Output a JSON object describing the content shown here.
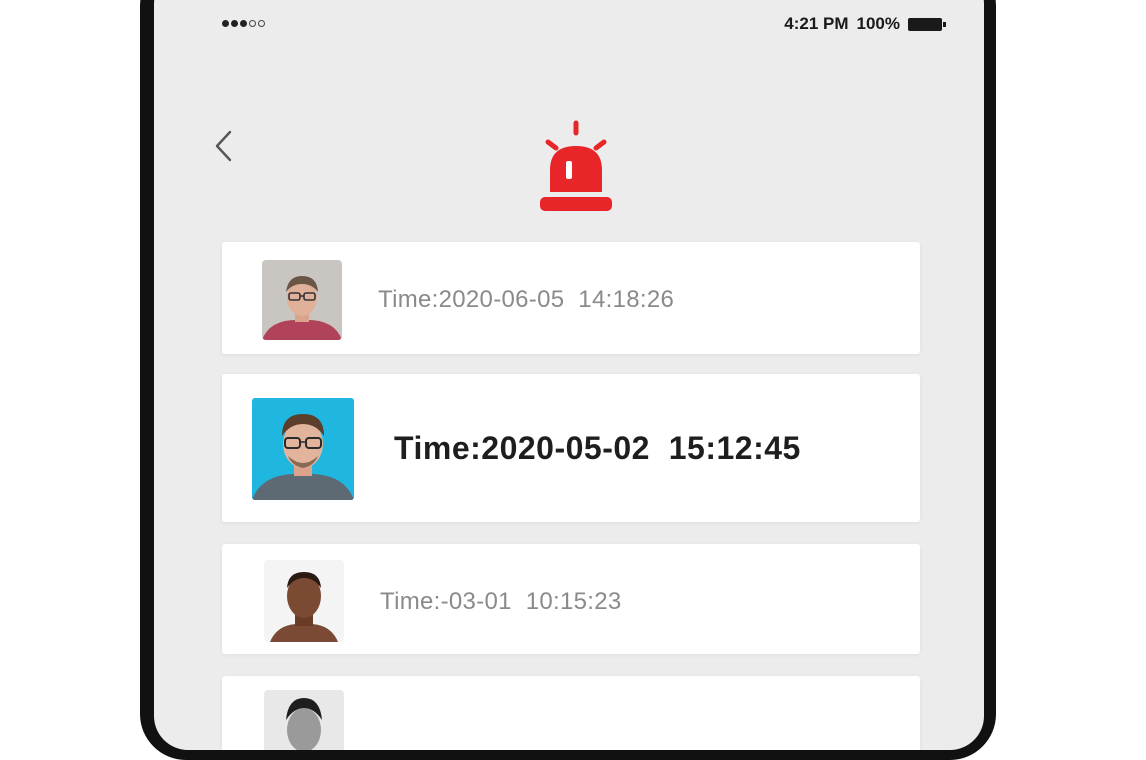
{
  "status_bar": {
    "time": "4:21 PM",
    "battery_percent": "100%",
    "signal_bars_filled": 3,
    "signal_bars_total": 5
  },
  "header": {
    "back_icon": "chevron-left-icon",
    "alarm_icon": "siren-alarm-icon",
    "accent_color": "#e8262a"
  },
  "records": [
    {
      "time": "Time:2020-06-05  14:18:26",
      "avatar": "person-avatar-glasses",
      "highlighted": false
    },
    {
      "time": "Time:2020-05-02  15:12:45",
      "avatar": "person-avatar-glasses-blue-bg",
      "highlighted": true
    },
    {
      "time": "Time:-03-01  10:15:23",
      "avatar": "person-avatar",
      "highlighted": false
    },
    {
      "time": "",
      "avatar": "person-avatar",
      "highlighted": false
    }
  ]
}
